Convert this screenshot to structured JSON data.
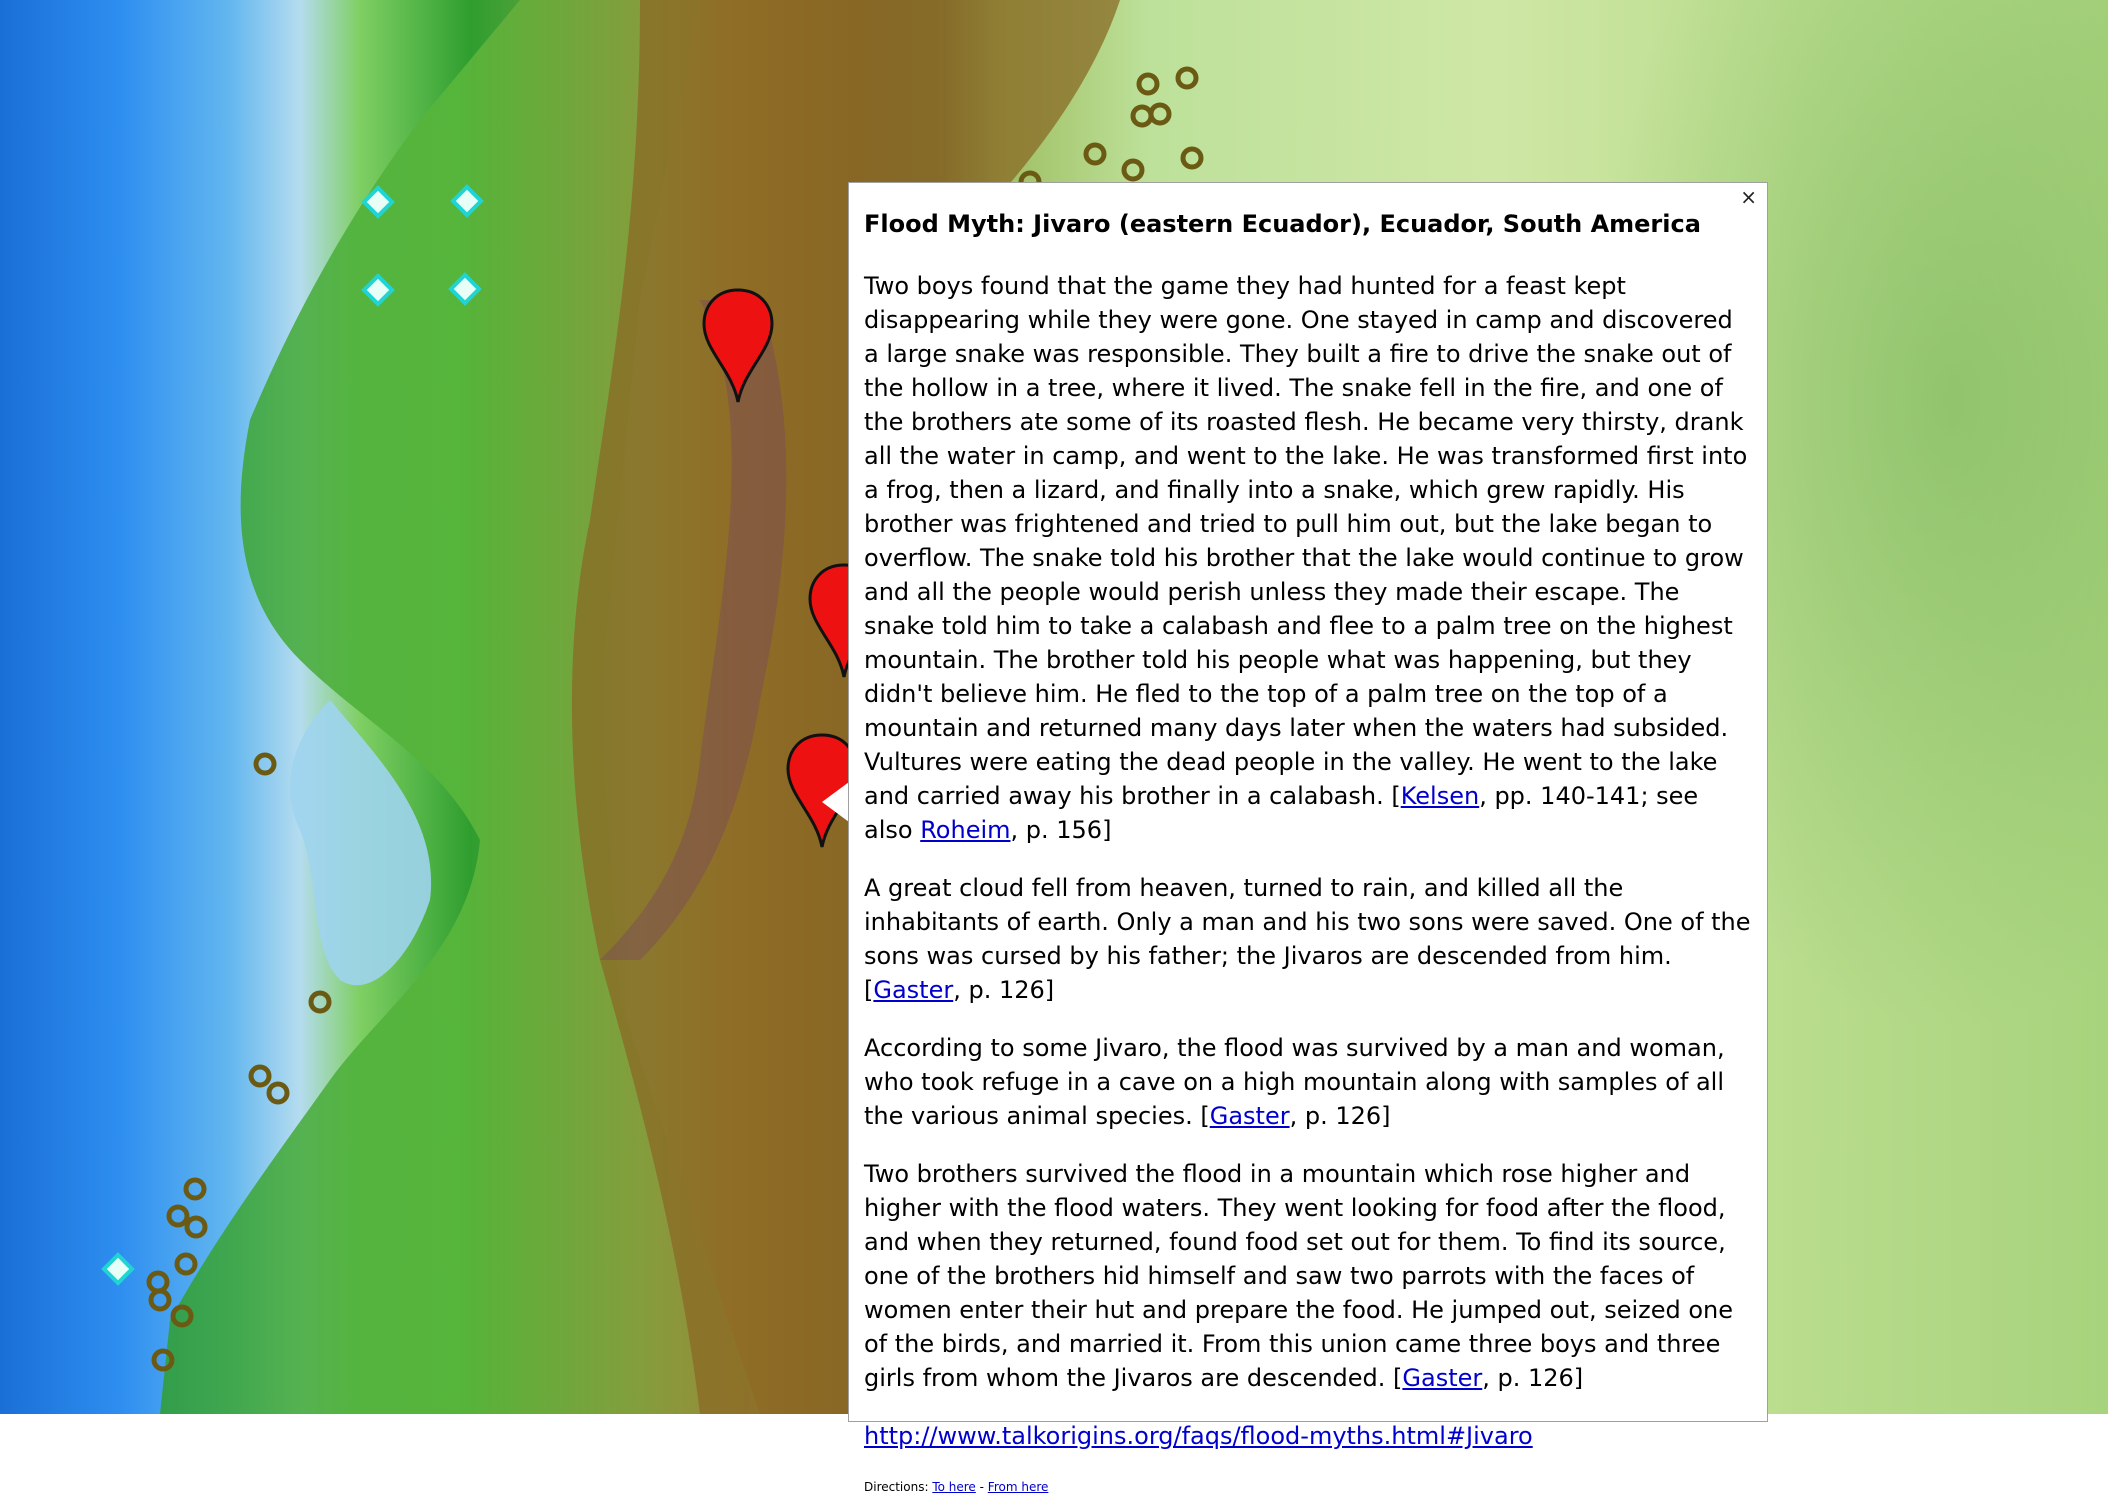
{
  "map": {
    "colors": {
      "ocean": "#2e8ef0",
      "shallow": "#b5dcef",
      "lowland": "#2f9e2f",
      "highland": "#a27b2c",
      "plain": "#cfe7a5",
      "marker_red": "#ee1111",
      "marker_ring": "#6b5a14",
      "marker_diamond": "#20d4d4"
    },
    "marker_icons": [
      "red-pin-icon",
      "brown-ring-icon",
      "cyan-diamond-icon"
    ]
  },
  "popup": {
    "close_label": "×",
    "title": "Flood Myth: Jivaro (eastern Ecuador), Ecuador, South America",
    "p1_text": "Two boys found that the game they had hunted for a feast kept disappearing while they were gone. One stayed in camp and discovered a large snake was responsible. They built a fire to drive the snake out of the hollow in a tree, where it lived. The snake fell in the fire, and one of the brothers ate some of its roasted flesh. He became very thirsty, drank all the water in camp, and went to the lake. He was transformed first into a frog, then a lizard, and finally into a snake, which grew rapidly. His brother was frightened and tried to pull him out, but the lake began to overflow. The snake told his brother that the lake would continue to grow and all the people would perish unless they made their escape. The snake told him to take a calabash and flee to a palm tree on the highest mountain. The brother told his people what was happening, but they didn't believe him. He fled to the top of a palm tree on the top of a mountain and returned many days later when the waters had subsided. Vultures were eating the dead people in the valley. He went to the lake and carried away his brother in a calabash. [",
    "p1_link1": "Kelsen",
    "p1_mid": ", pp. 140-141; see also ",
    "p1_link2": "Roheim",
    "p1_end": ", p. 156]",
    "p2_text": "A great cloud fell from heaven, turned to rain, and killed all the inhabitants of earth. Only a man and his two sons were saved. One of the sons was cursed by his father; the Jivaros are descended from him. [",
    "p2_link": "Gaster",
    "p2_end": ", p. 126]",
    "p3_text": "According to some Jivaro, the flood was survived by a man and woman, who took refuge in a cave on a high mountain along with samples of all the various animal species. [",
    "p3_link": "Gaster",
    "p3_end": ", p. 126]",
    "p4_text": "Two brothers survived the flood in a mountain which rose higher and higher with the flood waters. They went looking for food after the flood, and when they returned, found food set out for them. To find its source, one of the brothers hid himself and saw two parrots with the faces of women enter their hut and prepare the food. He jumped out, seized one of the birds, and married it. From this union came three boys and three girls from whom the Jivaros are descended. [",
    "p4_link": "Gaster",
    "p4_end": ", p. 126]",
    "url": "http://www.talkorigins.org/faqs/flood-myths.html#Jivaro",
    "directions_label": "Directions: ",
    "to_here": "To here",
    "sep": " - ",
    "from_here": "From here"
  }
}
